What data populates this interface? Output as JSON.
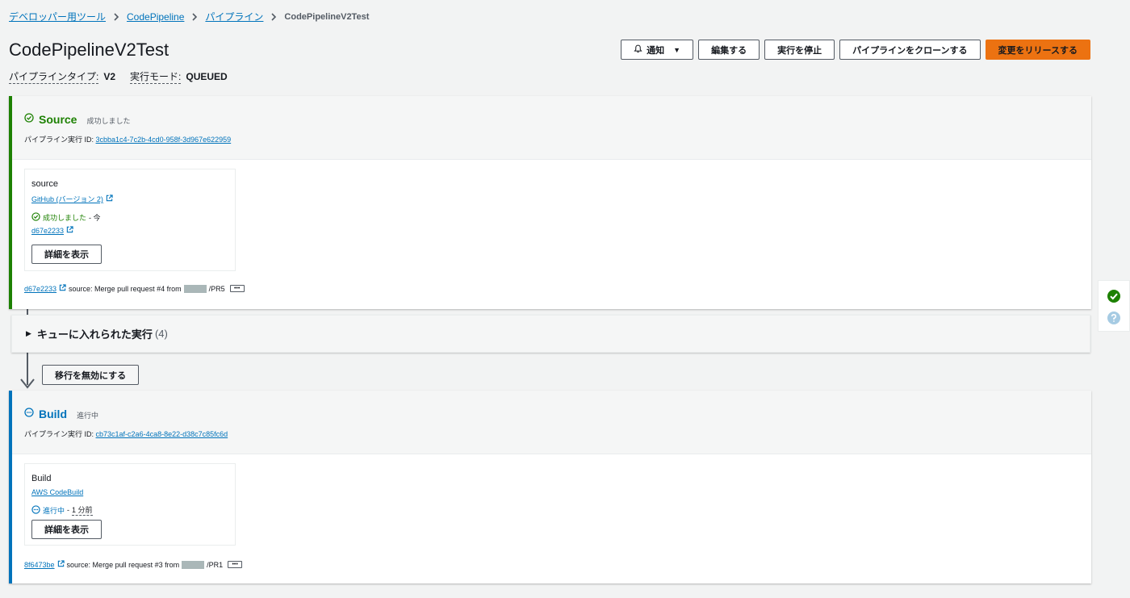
{
  "breadcrumb": {
    "items": [
      "デベロッパー用ツール",
      "CodePipeline",
      "パイプライン"
    ],
    "current": "CodePipelineV2Test"
  },
  "page": {
    "title": "CodePipelineV2Test",
    "type_label": "パイプラインタイプ:",
    "type_value": "V2",
    "mode_label": "実行モード:",
    "mode_value": "QUEUED"
  },
  "actions": {
    "notify": "通知",
    "edit": "編集する",
    "stop": "実行を停止",
    "clone": "パイプラインをクローンする",
    "release": "変更をリリースする"
  },
  "source_stage": {
    "name": "Source",
    "status": "成功しました",
    "exec_label": "パイプライン実行 ID:",
    "exec_id": "3cbba1c4-7c2b-4cd0-958f-3d967e622959",
    "action": {
      "name": "source",
      "provider": "GitHub (バージョン 2)",
      "status": "成功しました",
      "time": "- 今",
      "revision": "d67e2233",
      "detail_button": "詳細を表示"
    },
    "commit": {
      "id": "d67e2233",
      "message": "source: Merge pull request #4 from",
      "suffix": "/PR5"
    }
  },
  "queue": {
    "label": "キューに入れられた実行",
    "count": "(4)"
  },
  "transition": {
    "button": "移行を無効にする"
  },
  "build_stage": {
    "name": "Build",
    "status": "進行中",
    "exec_label": "パイプライン実行 ID:",
    "exec_id": "cb73c1af-c2a6-4ca8-8e22-d38c7c85fc6d",
    "action": {
      "name": "Build",
      "provider": "AWS CodeBuild",
      "status": "進行中",
      "time_sep": "-",
      "time": "1 分前",
      "detail_button": "詳細を表示"
    },
    "commit": {
      "id": "8f6473be",
      "message": "source: Merge pull request #3 from",
      "suffix": "/PR1"
    }
  },
  "colors": {
    "success": "#1d8102",
    "progress": "#0073bb",
    "primary": "#ec7211",
    "link": "#0073bb"
  }
}
